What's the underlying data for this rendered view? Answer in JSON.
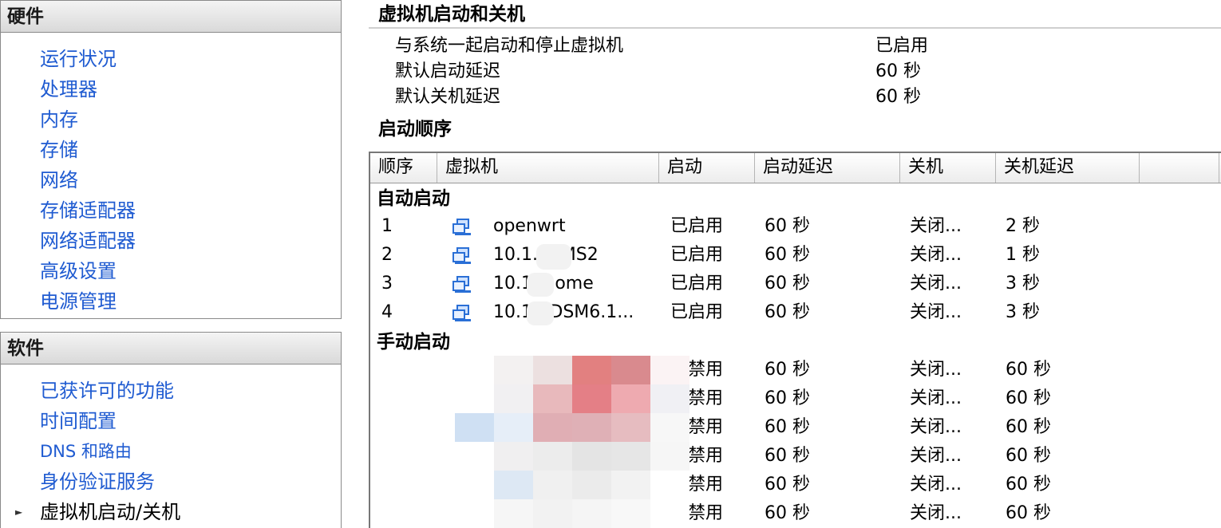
{
  "hardware": {
    "title": "硬件",
    "items": [
      "运行状况",
      "处理器",
      "内存",
      "存储",
      "网络",
      "存储适配器",
      "网络适配器",
      "高级设置",
      "电源管理"
    ]
  },
  "software": {
    "title": "软件",
    "items": [
      "已获许可的功能",
      "时间配置",
      "DNS 和路由",
      "身份验证服务",
      "虚拟机启动/关机"
    ]
  },
  "startup": {
    "title": "虚拟机启动和关机",
    "props": [
      {
        "label": "与系统一起启动和停止虚拟机",
        "value": "已启用"
      },
      {
        "label": "默认启动延迟",
        "value": "60 秒"
      },
      {
        "label": "默认关机延迟",
        "value": "60 秒"
      }
    ]
  },
  "order": {
    "title": "启动顺序",
    "columns": [
      "顺序",
      "虚拟机",
      "启动",
      "启动延迟",
      "关机",
      "关机延迟"
    ],
    "auto_group": "自动启动",
    "auto_rows": [
      {
        "order": "1",
        "vm": "openwrt",
        "start": "已启用",
        "start_delay": "60 秒",
        "stop": "关闭...",
        "stop_delay": "2 秒"
      },
      {
        "order": "2",
        "vm": "10.1.      /KMS2",
        "start": "已启用",
        "start_delay": "60 秒",
        "stop": "关闭...",
        "stop_delay": "1 秒"
      },
      {
        "order": "3",
        "vm": "10.1      /home",
        "start": "已启用",
        "start_delay": "60 秒",
        "stop": "关闭...",
        "stop_delay": "3 秒"
      },
      {
        "order": "4",
        "vm": "10.1      ./DSM6.1...",
        "start": "已启用",
        "start_delay": "60 秒",
        "stop": "关闭...",
        "stop_delay": "3 秒"
      }
    ],
    "manual_group": "手动启动",
    "manual_rows": [
      {
        "start": "已禁用",
        "start_delay": "60 秒",
        "stop": "关闭...",
        "stop_delay": "60 秒"
      },
      {
        "start": "已禁用",
        "start_delay": "60 秒",
        "stop": "关闭...",
        "stop_delay": "60 秒"
      },
      {
        "start": "已禁用",
        "start_delay": "60 秒",
        "stop": "关闭...",
        "stop_delay": "60 秒"
      },
      {
        "start": "已禁用",
        "start_delay": "60 秒",
        "stop": "关闭...",
        "stop_delay": "60 秒"
      },
      {
        "start": "已禁用",
        "start_delay": "60 秒",
        "stop": "关闭...",
        "stop_delay": "60 秒"
      },
      {
        "start": "已禁用",
        "start_delay": "60 秒",
        "stop": "关闭...",
        "stop_delay": "60 秒"
      }
    ]
  },
  "colors": {
    "link": "#1f5bd1",
    "vm_icon": "#2a6fd6"
  },
  "icons": {
    "vm": "virtual-machine-icon",
    "selection": "triangle-right-icon"
  }
}
